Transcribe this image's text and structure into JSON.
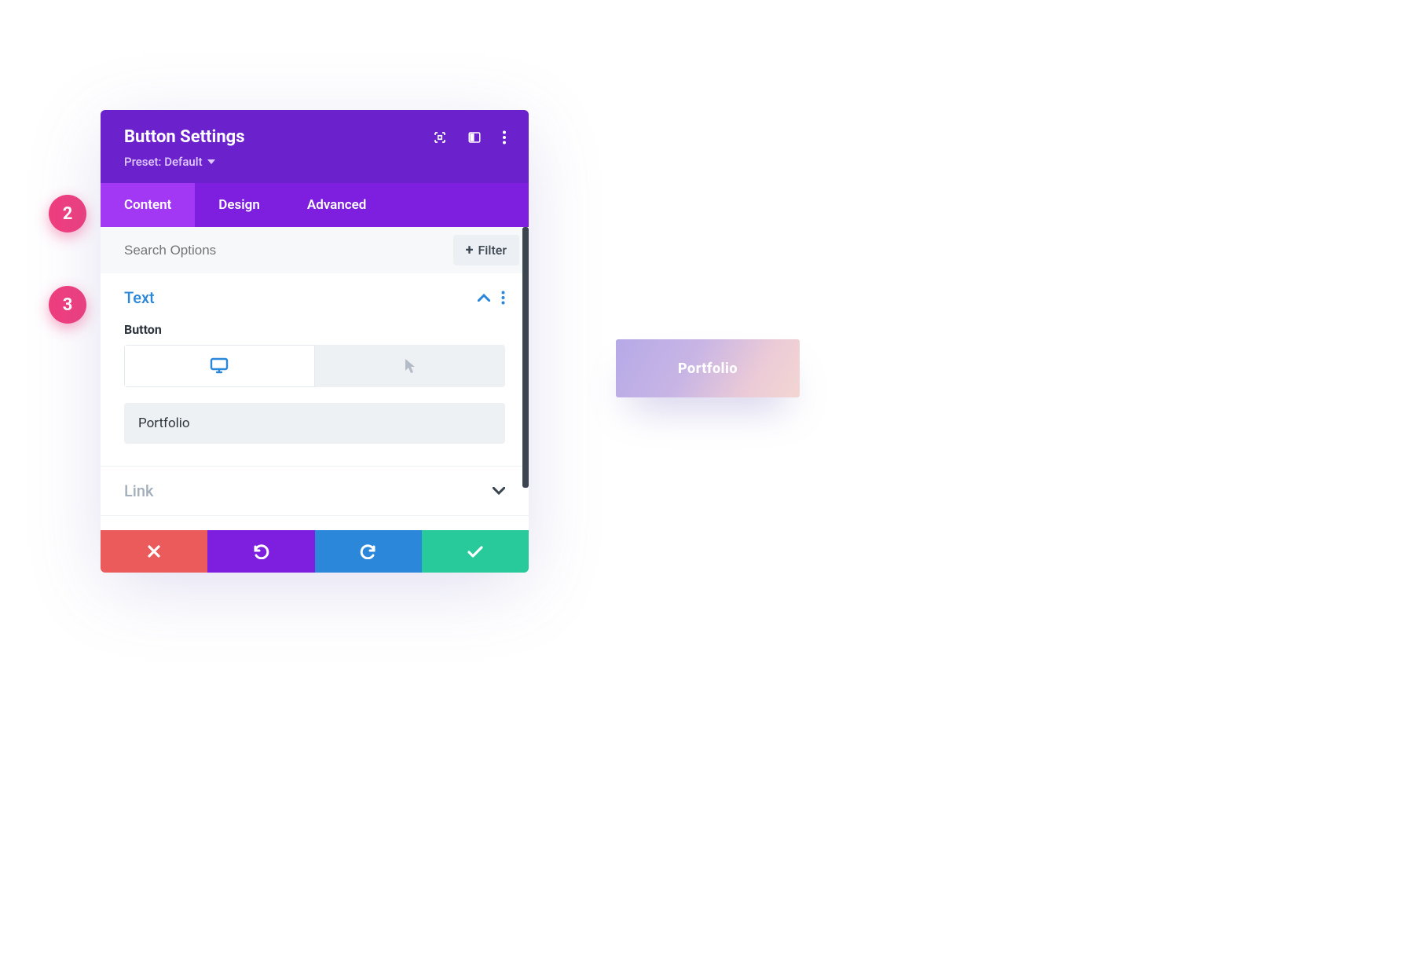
{
  "panel": {
    "title": "Button Settings",
    "preset_label": "Preset: Default"
  },
  "tabs": {
    "items": [
      "Content",
      "Design",
      "Advanced"
    ],
    "active": "Content"
  },
  "search": {
    "placeholder": "Search Options",
    "filter_label": "Filter"
  },
  "sections": {
    "text": {
      "title": "Text",
      "field_label": "Button",
      "input_value": "Portfolio"
    },
    "link": {
      "title": "Link"
    }
  },
  "callouts": {
    "b2": "2",
    "b3": "3"
  },
  "preview": {
    "button_label": "Portfolio"
  },
  "colors": {
    "header": "#6b22cd",
    "tabs_bg": "#7e1fe0",
    "tab_active": "#a338f4",
    "cancel": "#eb5b5b",
    "undo": "#7e1fe0",
    "redo": "#2b87da",
    "confirm": "#28c99a",
    "badge": "#ef3e7e",
    "section_open": "#2b87da"
  }
}
